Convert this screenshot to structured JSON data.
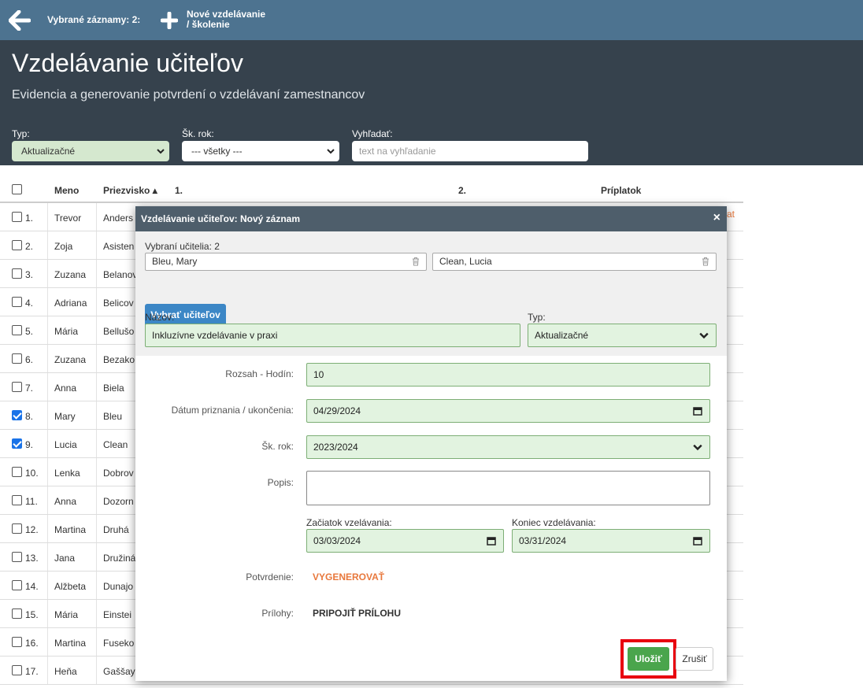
{
  "toolbar": {
    "selected_label": "Vybrané záznamy: 2:",
    "new_line1": "Nové vzdelávanie",
    "new_line2": "/ školenie"
  },
  "header": {
    "title": "Vzdelávanie učiteľov",
    "subtitle": "Evidencia a generovanie potvrdení o vzdelávaní zamestnancov"
  },
  "filters": {
    "type_label": "Typ:",
    "type_value": "Aktualizačné",
    "year_label": "Šk. rok:",
    "year_value": "--- všetky ---",
    "search_label": "Vyhľadať:",
    "search_placeholder": "text na vyhľadanie"
  },
  "table": {
    "columns": [
      "Meno",
      "Priezvisko ▴",
      "1.",
      "2.",
      "Príplatok"
    ],
    "rows": [
      {
        "num": "1.",
        "first": "Trevor",
        "last": "Anders",
        "checked": false
      },
      {
        "num": "2.",
        "first": "Zoja",
        "last": "Asisten",
        "checked": false
      },
      {
        "num": "3.",
        "first": "Zuzana",
        "last": "Belanov",
        "checked": false
      },
      {
        "num": "4.",
        "first": "Adriana",
        "last": "Belicov",
        "checked": false
      },
      {
        "num": "5.",
        "first": "Mária",
        "last": "Bellušo",
        "checked": false
      },
      {
        "num": "6.",
        "first": "Zuzana",
        "last": "Bezako",
        "checked": false
      },
      {
        "num": "7.",
        "first": "Anna",
        "last": "Biela",
        "checked": false
      },
      {
        "num": "8.",
        "first": "Mary",
        "last": "Bleu",
        "checked": true
      },
      {
        "num": "9.",
        "first": "Lucia",
        "last": "Clean",
        "checked": true
      },
      {
        "num": "10.",
        "first": "Lenka",
        "last": "Dobrov",
        "checked": false
      },
      {
        "num": "11.",
        "first": "Anna",
        "last": "Dozorn",
        "checked": false
      },
      {
        "num": "12.",
        "first": "Martina",
        "last": "Druhá",
        "checked": false
      },
      {
        "num": "13.",
        "first": "Jana",
        "last": "Družiná",
        "checked": false
      },
      {
        "num": "14.",
        "first": "Alžbeta",
        "last": "Dunajo",
        "checked": false
      },
      {
        "num": "15.",
        "first": "Mária",
        "last": "Einstei",
        "checked": false
      },
      {
        "num": "16.",
        "first": "Martina",
        "last": "Fuseko",
        "checked": false
      },
      {
        "num": "17.",
        "first": "Heňa",
        "last": "Gaššay",
        "checked": false
      }
    ],
    "peek_link": "at"
  },
  "modal": {
    "title": "Vzdelávanie učiteľov: Nový záznam",
    "close": "×",
    "selected_teachers_label": "Vybraní učitelia: 2",
    "teacher1": "Bleu, Mary",
    "teacher2": "Clean, Lucia",
    "pick_button": "Vybrať učiteľov",
    "name_label": "Názov:",
    "name_value": "Inkluzívne vzdelávanie v praxi",
    "type_label": "Typ:",
    "type_value": "Aktualizačné",
    "hours_label": "Rozsah - Hodín:",
    "hours_value": "10",
    "date_label": "Dátum priznania / ukončenia:",
    "date_value": "04/29/2024",
    "year_label": "Šk. rok:",
    "year_value": "2023/2024",
    "desc_label": "Popis:",
    "start_label": "Začiatok vzelávania:",
    "start_value": "03/03/2024",
    "end_label": "Koniec vzdelávania:",
    "end_value": "03/31/2024",
    "confirm_label": "Potvrdenie:",
    "confirm_link": "VYGENEROVAŤ",
    "attach_label": "Prílohy:",
    "attach_link": "PRIPOJIŤ PRÍLOHU",
    "save": "Uložiť",
    "cancel": "Zrušiť"
  },
  "colors": {
    "toolbar": "#4d7390",
    "header": "#36424d",
    "accent_green": "#4aa54c",
    "link_orange": "#e8783c",
    "highlight_red": "#e8000f"
  }
}
